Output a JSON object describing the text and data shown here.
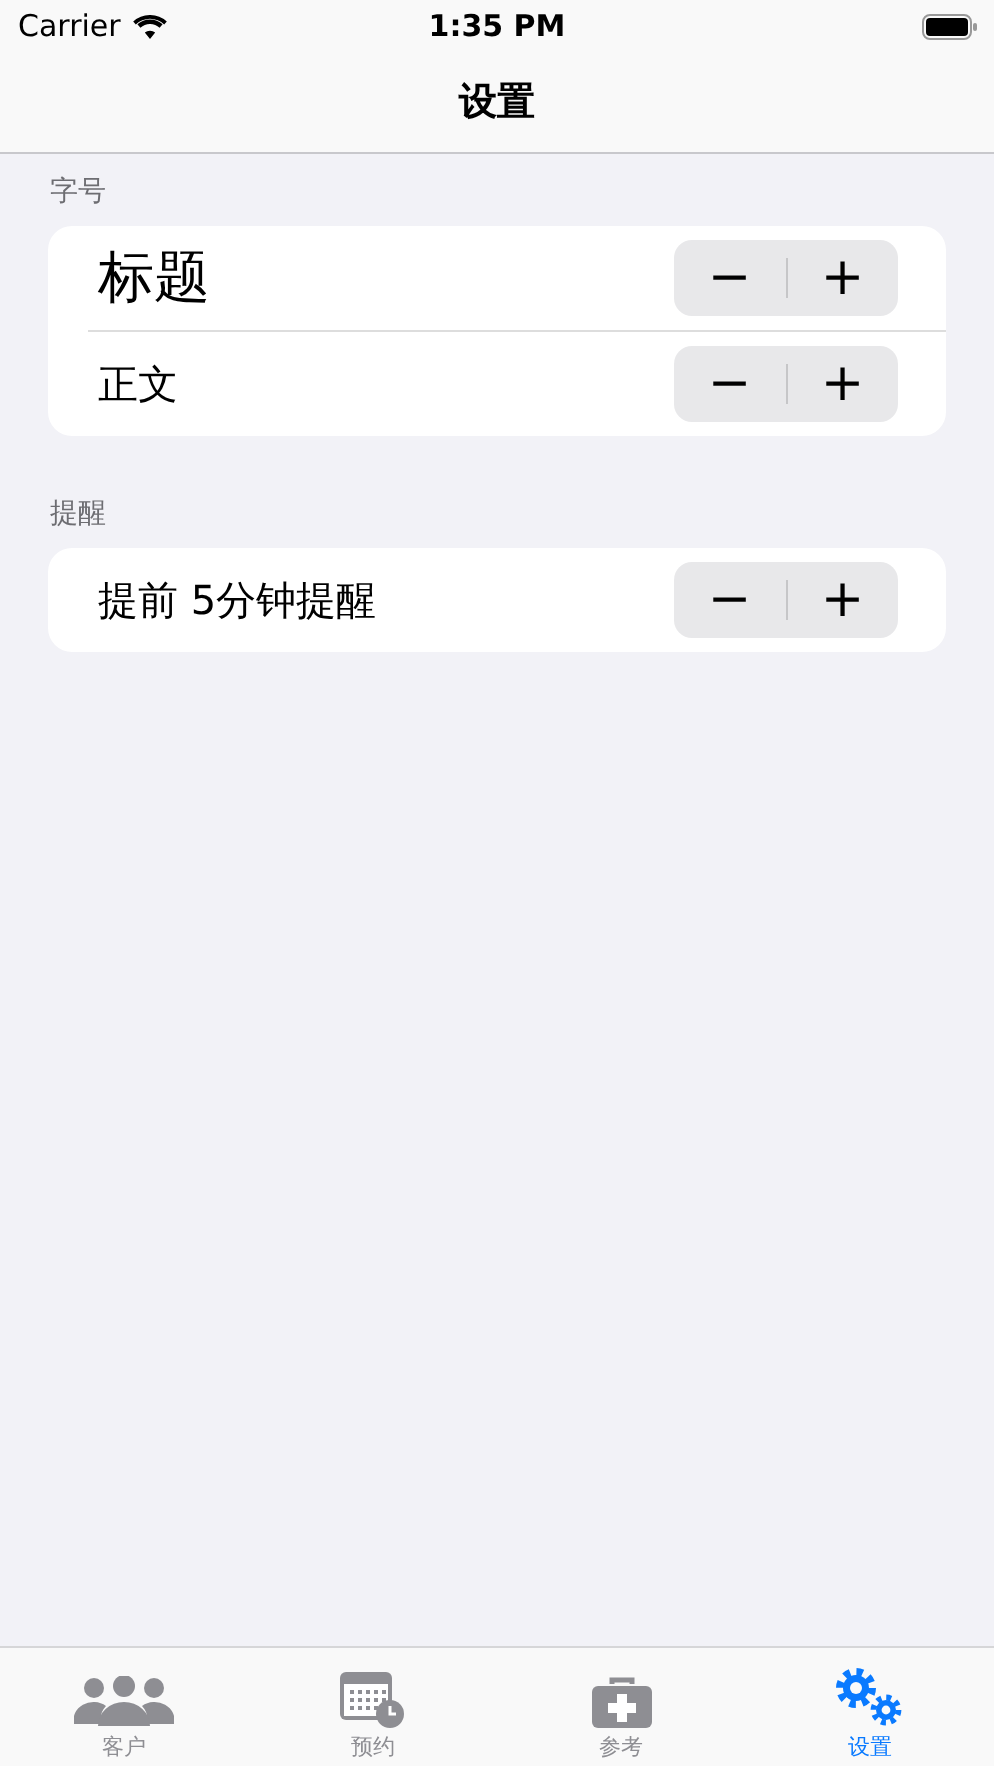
{
  "status_bar": {
    "carrier": "Carrier",
    "time": "1:35 PM"
  },
  "nav": {
    "title": "设置"
  },
  "sections": [
    {
      "header": "字号",
      "rows": [
        {
          "label": "标题",
          "kind": "large",
          "minus": "−",
          "plus": "+"
        },
        {
          "label": "正文",
          "kind": "normal",
          "minus": "−",
          "plus": "+"
        }
      ]
    },
    {
      "header": "提醒",
      "rows": [
        {
          "label": "提前  5分钟提醒",
          "kind": "normal",
          "minus": "−",
          "plus": "+"
        }
      ]
    }
  ],
  "tabs": [
    {
      "label": "客户",
      "selected": false
    },
    {
      "label": "预约",
      "selected": false
    },
    {
      "label": "参考",
      "selected": false
    },
    {
      "label": "设置",
      "selected": true
    }
  ]
}
